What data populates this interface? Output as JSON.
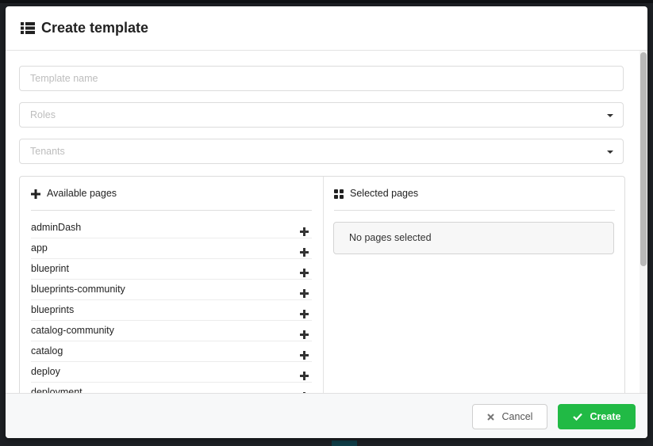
{
  "modal": {
    "title": "Create template",
    "title_icon": "list-icon"
  },
  "form": {
    "template_name": {
      "placeholder": "Template name",
      "value": ""
    },
    "roles": {
      "placeholder": "Roles"
    },
    "tenants": {
      "placeholder": "Tenants"
    }
  },
  "available_pages": {
    "header": "Available pages",
    "header_icon": "plus-icon",
    "items": [
      {
        "label": "adminDash"
      },
      {
        "label": "app"
      },
      {
        "label": "blueprint"
      },
      {
        "label": "blueprints-community"
      },
      {
        "label": "blueprints"
      },
      {
        "label": "catalog-community"
      },
      {
        "label": "catalog"
      },
      {
        "label": "deploy"
      },
      {
        "label": "deployment"
      }
    ]
  },
  "selected_pages": {
    "header": "Selected pages",
    "header_icon": "grid-icon",
    "empty_text": "No pages selected"
  },
  "footer": {
    "cancel_label": "Cancel",
    "create_label": "Create"
  },
  "colors": {
    "accent_green": "#21ba45",
    "backdrop": "#1d2024"
  }
}
